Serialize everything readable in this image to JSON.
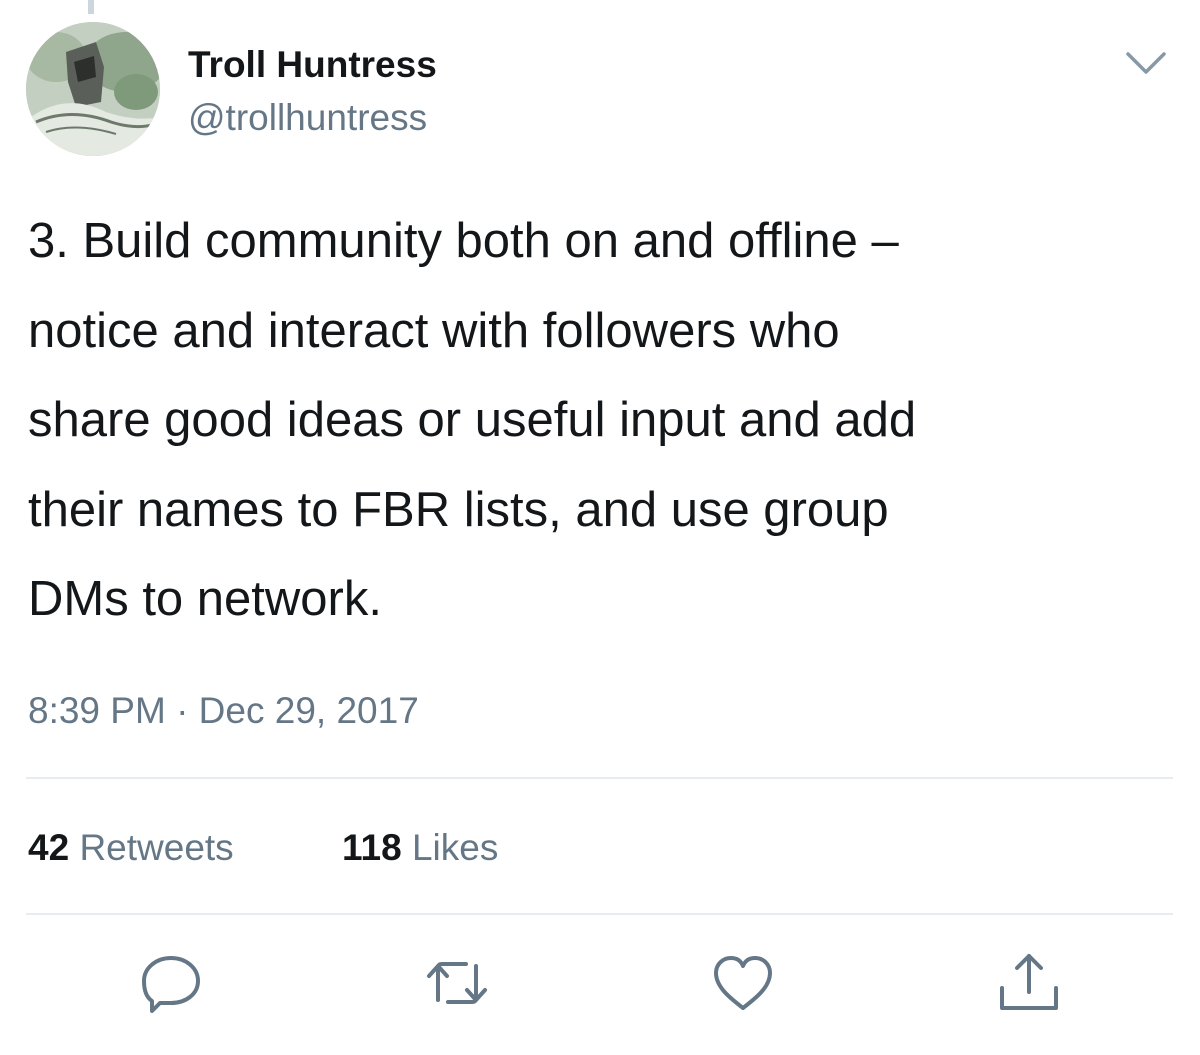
{
  "author": {
    "display_name": "Troll Huntress",
    "handle": "@trollhuntress",
    "avatar_icon": "avatar-image"
  },
  "tweet": {
    "text": "3. Build community both on and offline –\nnotice and interact with followers who\nshare good ideas or useful input and add\ntheir names to FBR lists, and use group\nDMs to network.",
    "timestamp": "8:39 PM · Dec 29, 2017"
  },
  "stats": {
    "retweets_count": "42",
    "retweets_label": "Retweets",
    "likes_count": "118",
    "likes_label": "Likes"
  },
  "actions": {
    "reply_icon": "reply-icon",
    "retweet_icon": "retweet-icon",
    "like_icon": "heart-icon",
    "share_icon": "share-icon",
    "more_icon": "chevron-down-icon"
  },
  "colors": {
    "primary_text": "#14171a",
    "secondary_text": "#657786",
    "divider": "#e6ecf0",
    "icon": "#657786"
  }
}
